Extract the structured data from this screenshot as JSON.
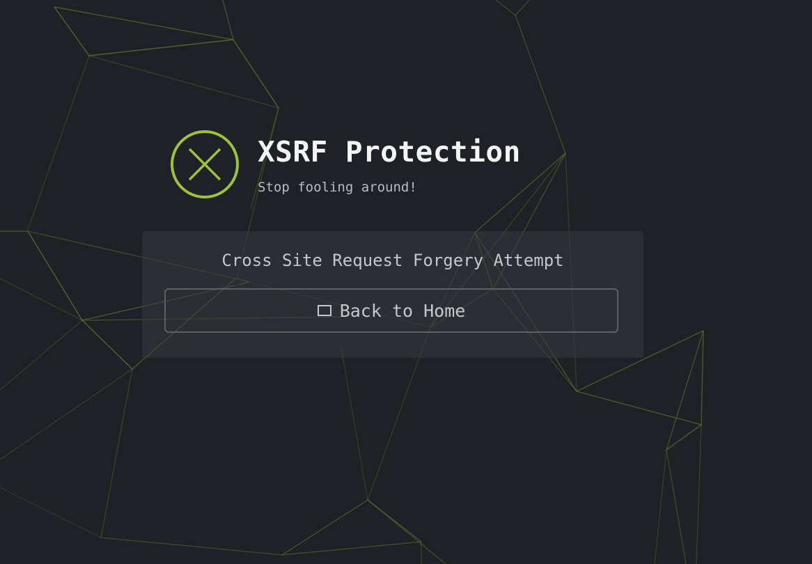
{
  "header": {
    "title": "XSRF Protection",
    "subtitle": "Stop fooling around!",
    "icon": "error-x-circle-icon",
    "accent_color": "#9bc43a"
  },
  "panel": {
    "message": "Cross Site Request Forgery Attempt",
    "button_label": "Back to Home",
    "button_icon": "home-icon"
  },
  "background": {
    "color": "#1e2126",
    "pattern": "low-poly-network",
    "line_color": "#6b7f2a"
  }
}
